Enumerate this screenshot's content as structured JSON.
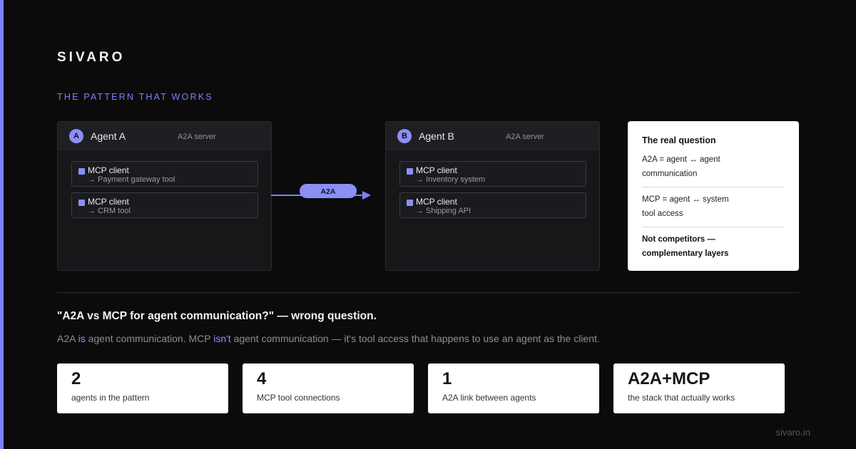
{
  "brand": "SIVARO",
  "section_label": "THE PATTERN THAT WORKS",
  "agents": [
    {
      "badge": "A",
      "name": "Agent A",
      "role": "A2A server",
      "tools": [
        {
          "title": "MCP client",
          "sub": "→ Payment gateway tool"
        },
        {
          "title": "MCP client",
          "sub": "→ CRM tool"
        }
      ]
    },
    {
      "badge": "B",
      "name": "Agent B",
      "role": "A2A server",
      "tools": [
        {
          "title": "MCP client",
          "sub": "→ Inventory system"
        },
        {
          "title": "MCP client",
          "sub": "→ Shipping API"
        }
      ]
    }
  ],
  "connector_label": "A2A",
  "question_card": {
    "title": "The real question",
    "line1a": "A2A = agent ↔ agent",
    "line1b": "communication",
    "line2a": "MCP = agent ↔ system",
    "line2b": "tool access",
    "line3a": "Not competitors —",
    "line3b": "complementary layers"
  },
  "headline": "\"A2A vs MCP for agent communication?\" — wrong question.",
  "subline": {
    "p1": "A2A ",
    "hl1": "is",
    "p2": " agent communication. MCP ",
    "hl2": "isn't",
    "p3": " agent communication — it's tool access that happens to use an agent as the client."
  },
  "stats": [
    {
      "value": "2",
      "label": "agents in the pattern"
    },
    {
      "value": "4",
      "label": "MCP tool connections"
    },
    {
      "value": "1",
      "label": "A2A link between agents"
    },
    {
      "value": "A2A+MCP",
      "label": "the stack that actually works"
    }
  ],
  "footer_url": "sivaro.in",
  "colors": {
    "accent": "#7c82ff",
    "badge": "#8b8ff5",
    "background": "#0b0b0c"
  }
}
